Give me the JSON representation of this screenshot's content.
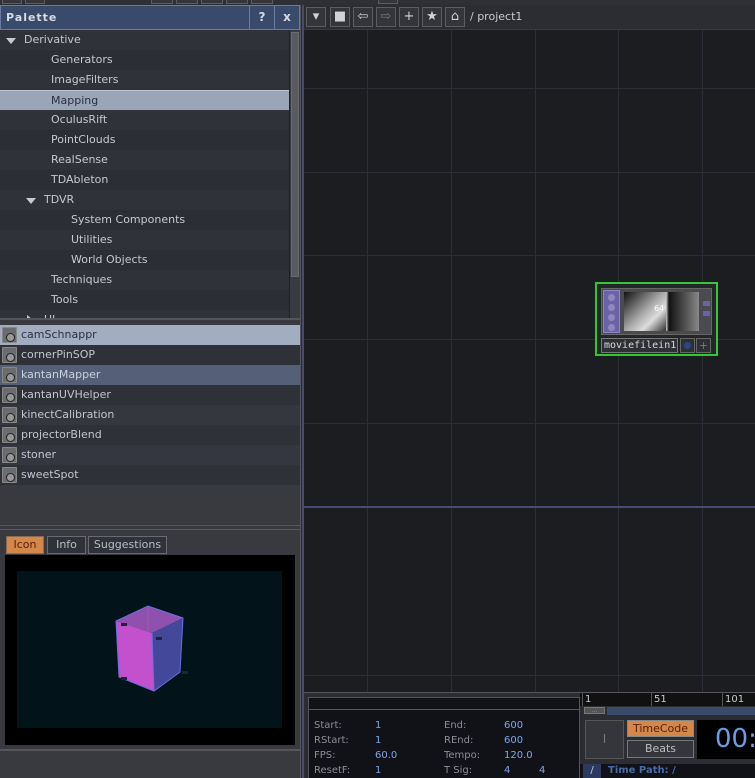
{
  "palette": {
    "title": "Palette",
    "help_label": "?",
    "close_label": "x",
    "tree": [
      {
        "label": "Derivative",
        "depth": 0,
        "expander": "expanded"
      },
      {
        "label": "Generators",
        "depth": 1
      },
      {
        "label": "ImageFilters",
        "depth": 1
      },
      {
        "label": "Mapping",
        "depth": 1,
        "selected": true
      },
      {
        "label": "OculusRift",
        "depth": 1
      },
      {
        "label": "PointClouds",
        "depth": 1
      },
      {
        "label": "RealSense",
        "depth": 1
      },
      {
        "label": "TDAbleton",
        "depth": 1
      },
      {
        "label": "TDVR",
        "depth": 1,
        "expander": "expanded"
      },
      {
        "label": "System Components",
        "depth": 2
      },
      {
        "label": "Utilities",
        "depth": 2
      },
      {
        "label": "World Objects",
        "depth": 2
      },
      {
        "label": "Techniques",
        "depth": 1
      },
      {
        "label": "Tools",
        "depth": 1
      },
      {
        "label": "UI",
        "depth": 1,
        "expander": "collapsed"
      }
    ],
    "components": [
      {
        "label": "camSchnappr",
        "state": "hover"
      },
      {
        "label": "cornerPinSOP"
      },
      {
        "label": "kantanMapper",
        "state": "selected"
      },
      {
        "label": "kantanUVHelper"
      },
      {
        "label": "kinectCalibration"
      },
      {
        "label": "projectorBlend"
      },
      {
        "label": "stoner"
      },
      {
        "label": "sweetSpot"
      }
    ],
    "tabs": [
      {
        "label": "Icon",
        "active": true
      },
      {
        "label": "Info",
        "active": false
      },
      {
        "label": "Suggestions",
        "active": false
      }
    ],
    "preview_icon": "magenta-cube-icon"
  },
  "network": {
    "path": "/ project1",
    "toolbar": [
      {
        "icon": "dropdown-arrow-icon",
        "glyph": "▾"
      },
      {
        "icon": "stop-square-icon",
        "glyph": "■"
      },
      {
        "icon": "back-arrow-icon",
        "glyph": "⇦"
      },
      {
        "icon": "forward-arrow-icon",
        "glyph": "⇨"
      },
      {
        "icon": "plus-icon",
        "glyph": "+"
      },
      {
        "icon": "star-icon",
        "glyph": "★"
      },
      {
        "icon": "home-icon",
        "glyph": "⌂"
      }
    ],
    "operator": {
      "name": "moviefilein1",
      "thumb_text": "64",
      "border_color": "#34c634"
    }
  },
  "timeline": {
    "fields": [
      {
        "label": "Start:",
        "value": "1"
      },
      {
        "label": "End:",
        "value": "600"
      },
      {
        "label": "RStart:",
        "value": "1"
      },
      {
        "label": "REnd:",
        "value": "600"
      },
      {
        "label": "FPS:",
        "value": "60.0"
      },
      {
        "label": "Tempo:",
        "value": "120.0"
      },
      {
        "label": "ResetF:",
        "value": "1"
      },
      {
        "label": "T Sig:",
        "value": "4",
        "value2": "4"
      }
    ],
    "ruler": [
      "1",
      "51",
      "101"
    ],
    "range_handle": "...",
    "i_button": "I",
    "timecode_label": "TimeCode",
    "beats_label": "Beats",
    "clock": "00:",
    "path_slash": "/",
    "time_path": "Time Path: /"
  }
}
